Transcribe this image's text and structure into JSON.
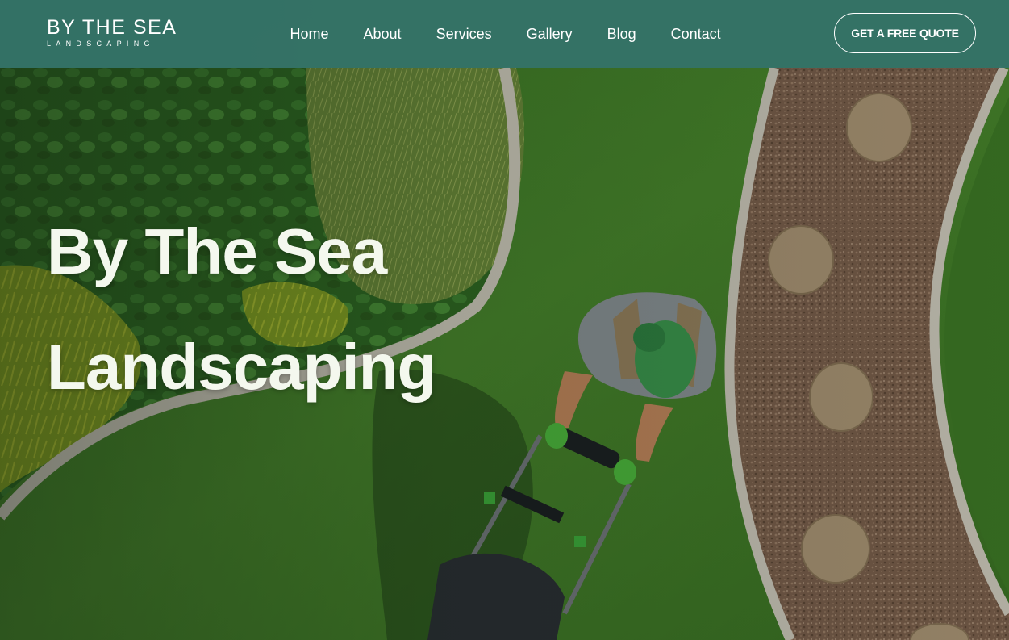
{
  "brand": {
    "logo_main": "BY THE SEA",
    "logo_sub": "LANDSCAPING"
  },
  "nav": {
    "items": [
      {
        "label": "Home"
      },
      {
        "label": "About"
      },
      {
        "label": "Services"
      },
      {
        "label": "Gallery"
      },
      {
        "label": "Blog"
      },
      {
        "label": "Contact"
      }
    ]
  },
  "cta": {
    "label": "GET A FREE QUOTE"
  },
  "hero": {
    "title_line1": "By The Sea",
    "title_line2": "Landscaping"
  },
  "colors": {
    "header_bg": "#347368",
    "text": "#ffffff",
    "hero_title": "#f4f8ee",
    "lawn": "#3f7a28",
    "gravel": "#8a6a55",
    "stone": "#a88f72"
  }
}
